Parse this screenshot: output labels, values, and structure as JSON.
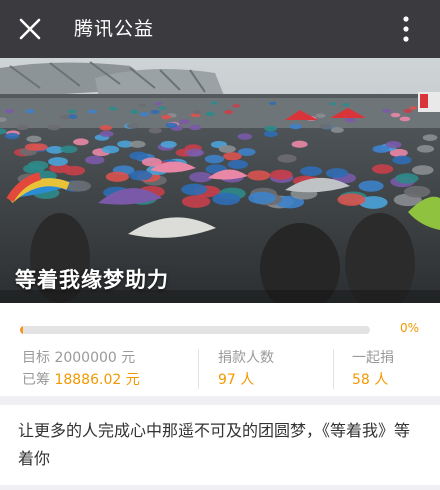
{
  "topbar": {
    "title": "腾讯公益",
    "icons": [
      "close-icon",
      "more-vertical-icon"
    ]
  },
  "banner": {
    "title": "等着我缘梦助力"
  },
  "progress": {
    "fraction": 0.0094,
    "percent_label": "0%"
  },
  "stats": {
    "target_label": "目标",
    "target_value": "2000000 元",
    "raised_label": "已筹",
    "raised_value": "18886.02",
    "raised_unit": "元",
    "donors_label": "捐款人数",
    "donors_value": "97",
    "donors_unit": "人",
    "together_label": "一起捐",
    "together_value": "58",
    "together_unit": "人"
  },
  "description": "让更多的人完成心中那遥不可及的团圆梦，《等着我》等着你",
  "colors": {
    "topbar": "#3a3a3f",
    "accent": "#f39800",
    "muted": "#9a9a9a"
  }
}
